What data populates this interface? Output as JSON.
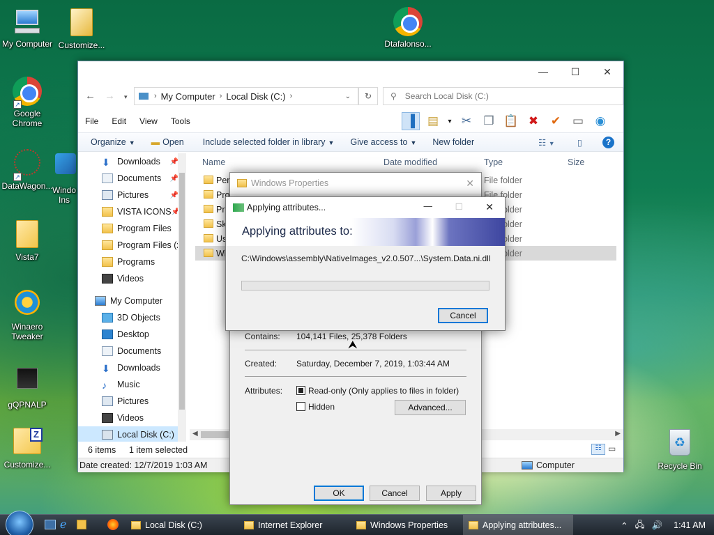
{
  "desktop": {
    "icons": [
      {
        "label": "My Computer"
      },
      {
        "label": "Customize..."
      },
      {
        "label": "Dtafalonso..."
      },
      {
        "label": "Google Chrome"
      },
      {
        "label": "DataWagon..."
      },
      {
        "label": "Windo Ins"
      },
      {
        "label": "Vista7"
      },
      {
        "label": "Winaero Tweaker"
      },
      {
        "label": "gQPNALP"
      },
      {
        "label": "Customize..."
      },
      {
        "label": "Recycle Bin"
      }
    ]
  },
  "explorer": {
    "titlebar": {
      "minimize": "—",
      "maximize": "☐",
      "close": "✕"
    },
    "address": {
      "segments": [
        "My Computer",
        "Local Disk (C:)"
      ]
    },
    "search": {
      "placeholder": "Search Local Disk (C:)"
    },
    "menu": [
      "File",
      "Edit",
      "View",
      "Tools"
    ],
    "commands": {
      "organize": "Organize",
      "open": "Open",
      "include": "Include selected folder in library",
      "share": "Give access to",
      "new_folder": "New folder"
    },
    "nav": {
      "quick": [
        "Downloads",
        "Documents",
        "Pictures",
        "VISTA ICONS",
        "Program Files",
        "Program Files (x",
        "Programs",
        "Videos"
      ],
      "computer": "My Computer",
      "computer_items": [
        "3D Objects",
        "Desktop",
        "Documents",
        "Downloads",
        "Music",
        "Pictures",
        "Videos",
        "Local Disk (C:)"
      ]
    },
    "columns": {
      "name": "Name",
      "date": "Date modified",
      "type": "Type",
      "size": "Size"
    },
    "files": [
      {
        "name": "Perf",
        "type": "File folder"
      },
      {
        "name": "Pro",
        "type": "File folder"
      },
      {
        "name": "Pro",
        "type": "File folder"
      },
      {
        "name": "Ski",
        "type": "File folder"
      },
      {
        "name": "Us",
        "type": "File folder"
      },
      {
        "name": "Wi",
        "type": "File folder"
      }
    ],
    "status": {
      "items": "6 items",
      "selected": "1 item selected"
    },
    "details": {
      "created": "Date created: 12/7/2019 1:03 AM",
      "location": "Computer"
    }
  },
  "properties": {
    "title": "Windows Properties",
    "contains_label": "Contains:",
    "contains_value": "104,141 Files, 25,378 Folders",
    "created_label": "Created:",
    "created_value": "Saturday, December 7, 2019, 1:03:44 AM",
    "attributes_label": "Attributes:",
    "readonly": "Read-only (Only applies to files in folder)",
    "hidden": "Hidden",
    "advanced": "Advanced...",
    "ok": "OK",
    "cancel": "Cancel",
    "apply": "Apply"
  },
  "applying": {
    "title": "Applying attributes...",
    "heading": "Applying attributes to:",
    "path": "C:\\Windows\\assembly\\NativeImages_v2.0.507...\\System.Data.ni.dll",
    "progress": 0.0,
    "cancel": "Cancel"
  },
  "taskbar": {
    "buttons": [
      "Local Disk (C:)",
      "Internet Explorer",
      "Windows Properties",
      "Applying attributes..."
    ],
    "time": "1:41 AM"
  }
}
